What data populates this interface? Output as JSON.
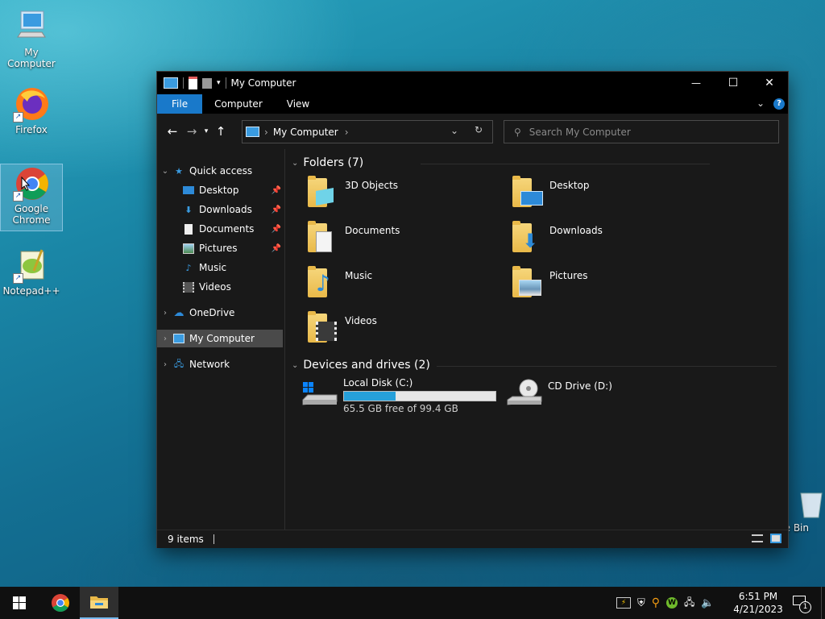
{
  "desktop": {
    "icons": [
      {
        "label": "My Computer"
      },
      {
        "label": "Firefox"
      },
      {
        "label": "Google Chrome"
      },
      {
        "label": "Notepad++"
      },
      {
        "label": "e Bin"
      }
    ]
  },
  "window": {
    "title": "My Computer",
    "controls": {
      "minimize": "—",
      "maximize": "☐",
      "close": "✕"
    },
    "ribbon": {
      "tabs": [
        "File",
        "Computer",
        "View"
      ],
      "help": "?"
    },
    "address": {
      "crumb": "My Computer"
    },
    "search": {
      "placeholder": "Search My Computer"
    },
    "nav": {
      "quick_access": "Quick access",
      "items": [
        "Desktop",
        "Downloads",
        "Documents",
        "Pictures",
        "Music",
        "Videos"
      ],
      "onedrive": "OneDrive",
      "my_computer": "My Computer",
      "network": "Network"
    },
    "folders": {
      "header": "Folders (7)",
      "items": [
        "3D Objects",
        "Desktop",
        "Documents",
        "Downloads",
        "Music",
        "Pictures",
        "Videos"
      ]
    },
    "drives": {
      "header": "Devices and drives (2)",
      "local": {
        "name": "Local Disk (C:)",
        "free": "65.5 GB free of 99.4 GB",
        "used_fraction": 0.34
      },
      "cd": {
        "name": "CD Drive (D:)"
      }
    },
    "status": {
      "items": "9 items"
    }
  },
  "taskbar": {
    "clock_time": "6:51 PM",
    "clock_date": "4/21/2023",
    "notification_count": "1"
  },
  "colors": {
    "accent": "#1979ca",
    "bar_fill": "#26a0da",
    "dark_bg": "#191919"
  }
}
